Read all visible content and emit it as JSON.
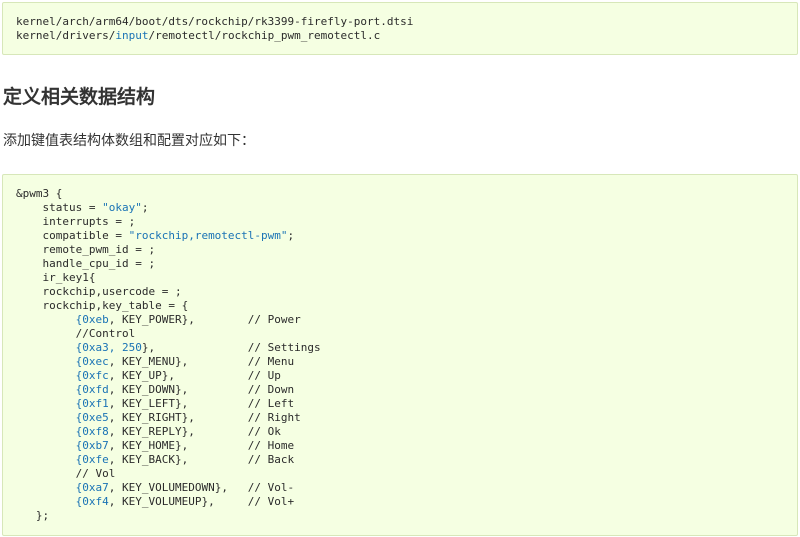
{
  "file_paths": {
    "line1": "kernel/arch/arm64/boot/dts/rockchip/rk3399-firefly-port.dtsi",
    "line2_pre": "kernel/drivers/",
    "line2_hl": "input",
    "line2_post": "/remotectl/rockchip_pwm_remotectl.c"
  },
  "heading": "定义相关数据结构",
  "paragraph": "添加键值表结构体数组和配置对应如下：",
  "code": {
    "l01": "&pwm3 {",
    "l02_a": "    status = ",
    "l02_s": "\"okay\"",
    "l02_b": ";",
    "l03": "    interrupts = ;",
    "l04_a": "    compatible = ",
    "l04_s": "\"rockchip,remotectl-pwm\"",
    "l04_b": ";",
    "l05": "    remote_pwm_id = ;",
    "l06": "    handle_cpu_id = ;",
    "l07": "    ir_key1{",
    "l08": "    rockchip,usercode = ;",
    "l09": "    rockchip,key_table = {",
    "keys": [
      {
        "a": "{",
        "v": "0xeb",
        "b": ", KEY_POWER},        // Power"
      },
      {
        "a": "//Control",
        "v": "",
        "b": ""
      },
      {
        "a": "{",
        "v": "0xa3, 250",
        "b": "},              // Settings"
      },
      {
        "a": "{",
        "v": "0xec",
        "b": ", KEY_MENU},         // Menu"
      },
      {
        "a": "{",
        "v": "0xfc",
        "b": ", KEY_UP},           // Up"
      },
      {
        "a": "{",
        "v": "0xfd",
        "b": ", KEY_DOWN},         // Down"
      },
      {
        "a": "{",
        "v": "0xf1",
        "b": ", KEY_LEFT},         // Left"
      },
      {
        "a": "{",
        "v": "0xe5",
        "b": ", KEY_RIGHT},        // Right"
      },
      {
        "a": "{",
        "v": "0xf8",
        "b": ", KEY_REPLY},        // Ok"
      },
      {
        "a": "{",
        "v": "0xb7",
        "b": ", KEY_HOME},         // Home"
      },
      {
        "a": "{",
        "v": "0xfe",
        "b": ", KEY_BACK},         // Back"
      },
      {
        "a": "// Vol",
        "v": "",
        "b": ""
      },
      {
        "a": "{",
        "v": "0xa7",
        "b": ", KEY_VOLUMEDOWN},   // Vol-"
      },
      {
        "a": "{",
        "v": "0xf4",
        "b": ", KEY_VOLUMEUP},     // Vol+"
      }
    ],
    "close": "   };"
  }
}
